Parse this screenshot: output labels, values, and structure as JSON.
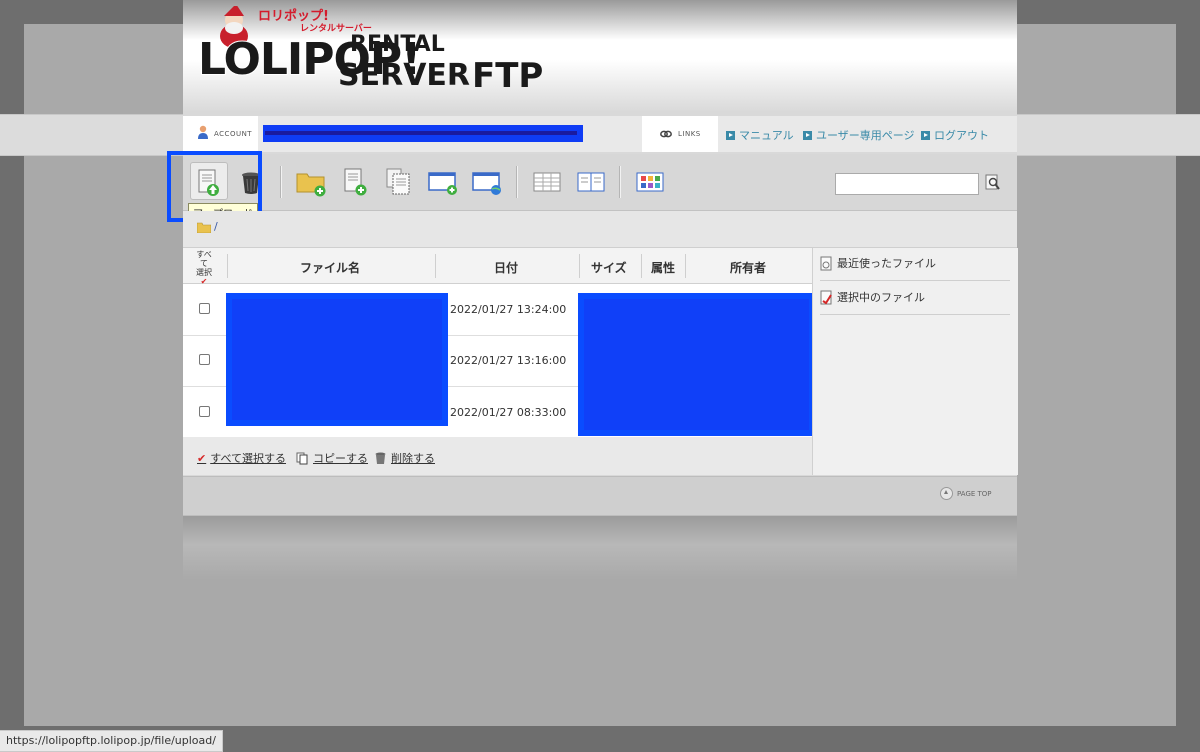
{
  "logo": {
    "badge": "ロリポップ!",
    "sub": "レンタルサーバー",
    "title": "LOLIPOP!",
    "rental": "RENTAL",
    "server": "SERVER",
    "ftp": "FTP"
  },
  "header": {
    "account_label": "ACCOUNT",
    "links_label": "LINKS",
    "nav": [
      {
        "label": "マニュアル"
      },
      {
        "label": "ユーザー専用ページ"
      },
      {
        "label": "ログアウト"
      }
    ]
  },
  "toolbar": {
    "tooltip": "アップロード",
    "search_value": "",
    "icons": [
      "upload-icon",
      "trash-icon",
      "new-folder-icon",
      "new-file-icon",
      "copy-icon",
      "window-add-icon",
      "window-globe-icon",
      "list-view-icon",
      "detail-view-icon",
      "thumbnail-view-icon"
    ]
  },
  "path": {
    "current": "/"
  },
  "table": {
    "select_all_header": [
      "すべて",
      "選択"
    ],
    "columns": [
      "ファイル名",
      "日付",
      "サイズ",
      "属性",
      "所有者"
    ],
    "rows": [
      {
        "date": "2022/01/27 13:24:00"
      },
      {
        "date": "2022/01/27 13:16:00"
      },
      {
        "date": "2022/01/27 08:33:00"
      }
    ]
  },
  "actions": {
    "select_all": "すべて選択する",
    "copy": "コピーする",
    "delete": "削除する"
  },
  "sidebar": {
    "recent": "最近使ったファイル",
    "selected": "選択中のファイル"
  },
  "footer": {
    "pagetop": "PAGE TOP"
  },
  "status_url": "https://lolipopftp.lolipop.jp/file/upload/",
  "colors": {
    "highlight": "#0a4cff",
    "link": "#3a8aa8",
    "redaction": "#0a4cff"
  }
}
